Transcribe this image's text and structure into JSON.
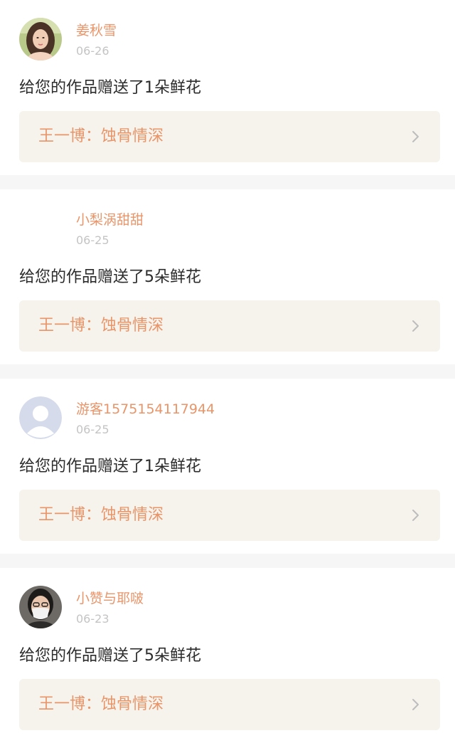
{
  "items": [
    {
      "user": "姜秋雪",
      "date": "06-26",
      "message": "给您的作品赠送了1朵鲜花",
      "work": "王一博：蚀骨情深",
      "avatar": "photo-avatar-woman"
    },
    {
      "user": "小梨涡甜甜",
      "date": "06-25",
      "message": "给您的作品赠送了5朵鲜花",
      "work": "王一博：蚀骨情深",
      "avatar": "none"
    },
    {
      "user": "游客1575154117944",
      "date": "06-25",
      "message": "给您的作品赠送了1朵鲜花",
      "work": "王一博：蚀骨情深",
      "avatar": "default-user-avatar"
    },
    {
      "user": "小赞与耶啵",
      "date": "06-23",
      "message": "给您的作品赠送了5朵鲜花",
      "work": "王一博：蚀骨情深",
      "avatar": "photo-avatar-masked"
    }
  ],
  "colors": {
    "accent": "#e8956a",
    "date": "#c4c4c4",
    "text": "#2b2b2b",
    "card_bg": "#f5f3ec",
    "separator": "#f6f6f6"
  }
}
